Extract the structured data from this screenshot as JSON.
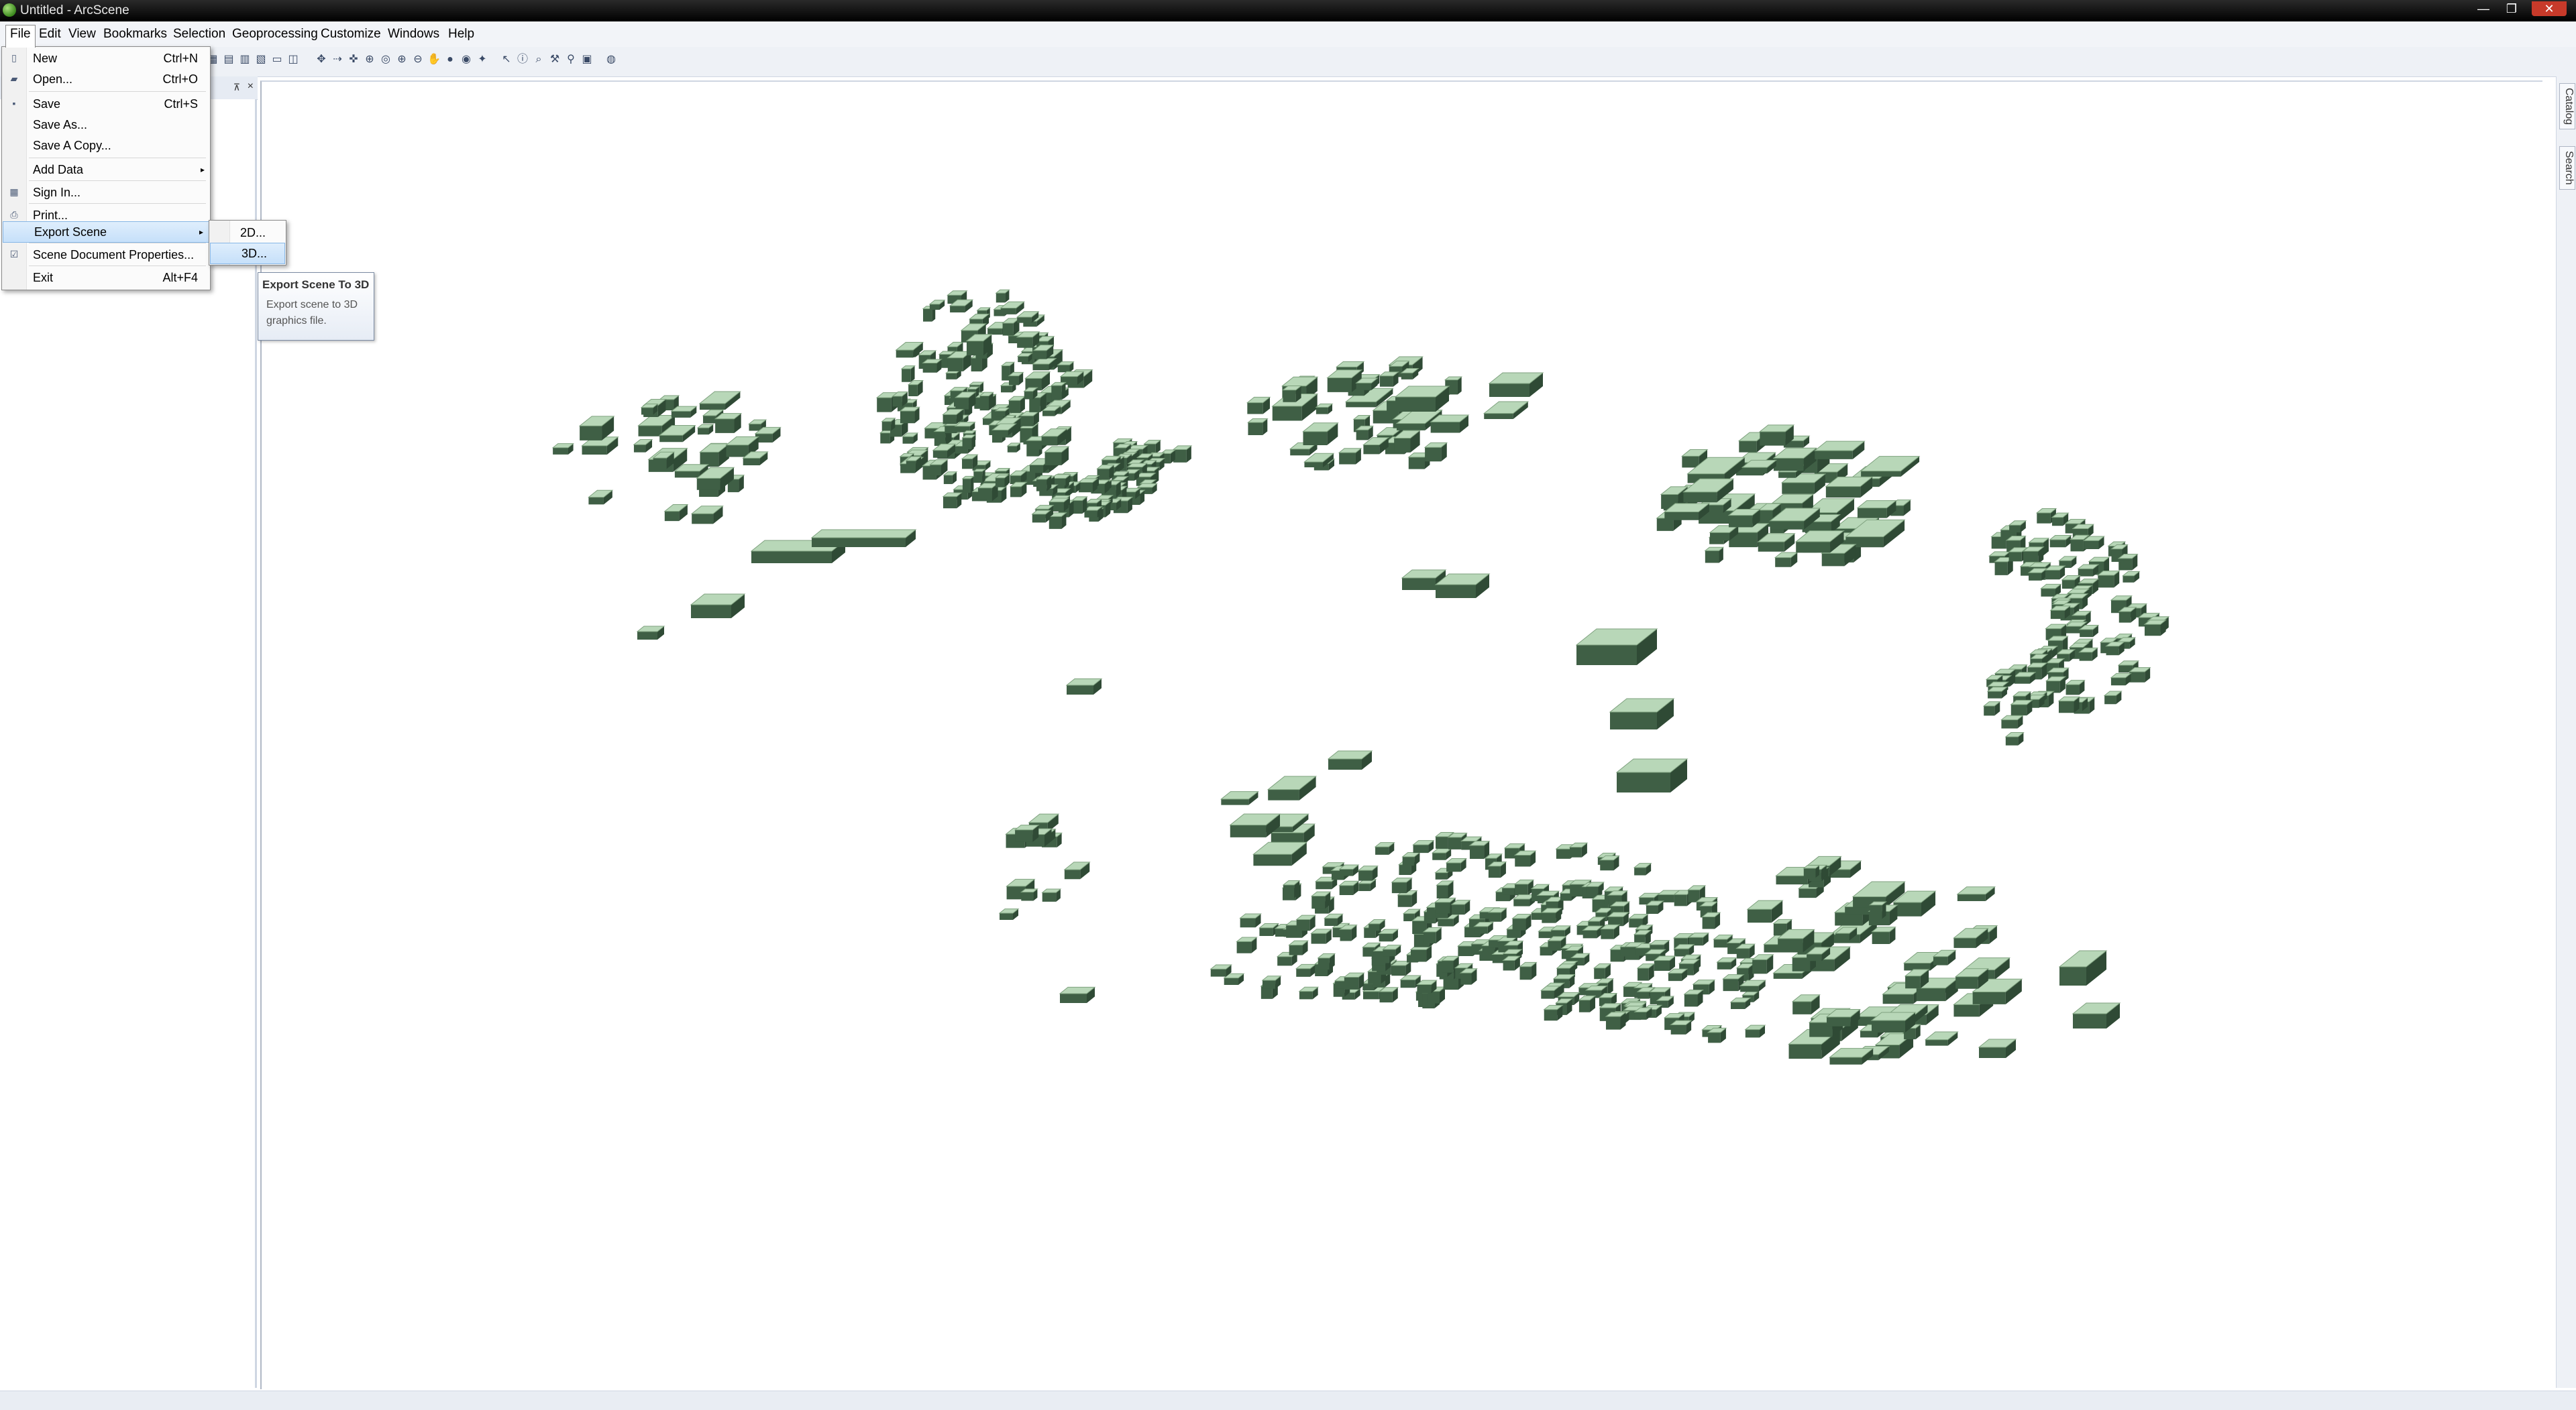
{
  "window": {
    "title": "Untitled - ArcScene",
    "min": "—",
    "max": "❐",
    "close": "✕"
  },
  "menubar": [
    "File",
    "Edit",
    "View",
    "Bookmarks",
    "Selection",
    "Geoprocessing",
    "Customize",
    "Windows",
    "Help"
  ],
  "file_menu": {
    "items": [
      {
        "label": "New",
        "shortcut": "Ctrl+N",
        "icon": "new-document-icon"
      },
      {
        "label": "Open...",
        "shortcut": "Ctrl+O",
        "icon": "open-folder-icon"
      },
      {
        "label": "Save",
        "shortcut": "Ctrl+S",
        "icon": "save-icon"
      },
      {
        "label": "Save As...",
        "shortcut": ""
      },
      {
        "label": "Save A Copy...",
        "shortcut": ""
      },
      {
        "label": "Add Data",
        "shortcut": "",
        "submenu": true
      },
      {
        "label": "Sign In...",
        "shortcut": "",
        "icon": "sign-in-icon"
      },
      {
        "label": "Print...",
        "shortcut": "",
        "icon": "print-icon"
      },
      {
        "label": "Export Scene",
        "shortcut": "",
        "submenu": true,
        "highlighted": true
      },
      {
        "label": "Scene Document Properties...",
        "shortcut": "",
        "icon": "properties-icon"
      },
      {
        "label": "Exit",
        "shortcut": "Alt+F4"
      }
    ]
  },
  "export_submenu": {
    "items": [
      "2D...",
      "3D..."
    ],
    "highlighted": "3D..."
  },
  "tooltip": {
    "title": "Export Scene To 3D",
    "body": "Export scene to 3D graphics file."
  },
  "right_dock": {
    "tabs": [
      "Catalog",
      "Search"
    ]
  },
  "toc": {
    "pin": "⊼",
    "close": "×"
  },
  "colors": {
    "building_face": "#b8d7b8",
    "building_side": "#3f5f45",
    "building_edge": "#7fa27f",
    "highlight": "#c6e0fa"
  }
}
